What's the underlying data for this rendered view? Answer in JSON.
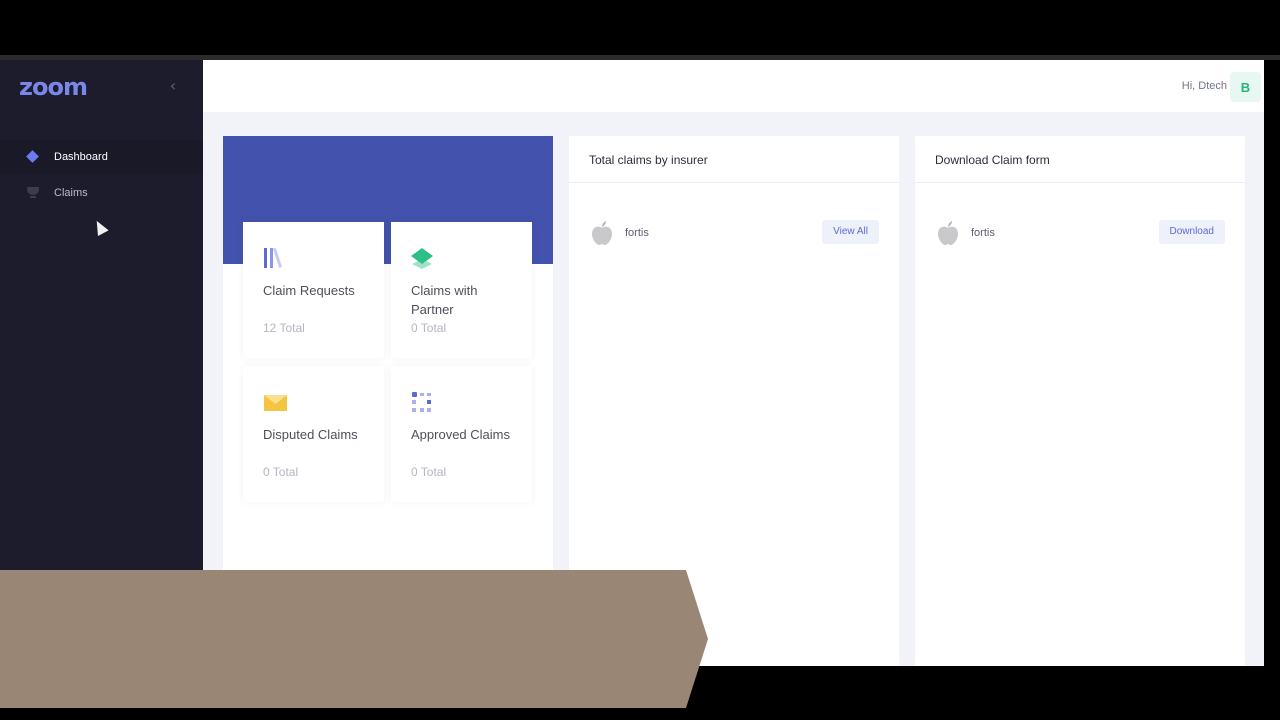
{
  "brand": {
    "logo_text": "zoom",
    "accent": "#6b7cf0",
    "sidebar_bg": "#1c1c2d"
  },
  "sidebar": {
    "collapse_icon": "chevron-left-icon",
    "items": [
      {
        "label": "Dashboard",
        "icon": "diamond-icon",
        "active": true
      },
      {
        "label": "Claims",
        "icon": "trophy-icon",
        "active": false
      }
    ]
  },
  "header": {
    "greeting": "Hi, Dtech",
    "avatar_initial": "B"
  },
  "stats": {
    "banner_color": "#4353ad",
    "cards": [
      {
        "title": "Claim Requests",
        "total": "12 Total",
        "icon": "books-icon"
      },
      {
        "title": "Claims with Partner",
        "total": "0 Total",
        "icon": "layers-icon"
      },
      {
        "title": "Disputed Claims",
        "total": "0 Total",
        "icon": "envelope-icon"
      },
      {
        "title": "Approved Claims",
        "total": "0 Total",
        "icon": "grid-dots-icon"
      }
    ]
  },
  "insurer_panel": {
    "title": "Total claims by insurer",
    "rows": [
      {
        "name": "fortis",
        "icon": "apple-icon",
        "action": "View All"
      }
    ]
  },
  "download_panel": {
    "title": "Download Claim form",
    "rows": [
      {
        "name": "fortis",
        "icon": "apple-icon",
        "action": "Download"
      }
    ]
  }
}
